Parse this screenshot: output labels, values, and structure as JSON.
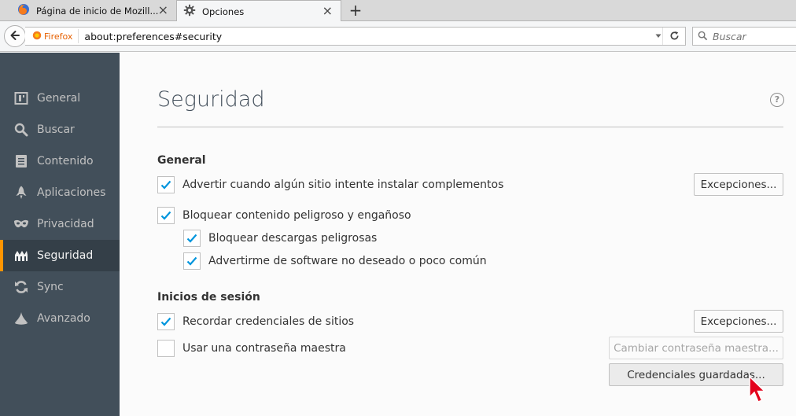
{
  "tabs": [
    {
      "title": "Página de inicio de Mozill...",
      "close": "×"
    },
    {
      "title": "Opciones",
      "close": "×"
    }
  ],
  "new_tab": "+",
  "navbar": {
    "identity_label": "Firefox",
    "url": "about:preferences#security",
    "search_placeholder": "Buscar"
  },
  "sidebar": {
    "items": [
      {
        "label": "General",
        "icon": "general-icon"
      },
      {
        "label": "Buscar",
        "icon": "search-icon"
      },
      {
        "label": "Contenido",
        "icon": "document-icon"
      },
      {
        "label": "Aplicaciones",
        "icon": "rocket-icon"
      },
      {
        "label": "Privacidad",
        "icon": "mask-icon"
      },
      {
        "label": "Seguridad",
        "icon": "security-icon",
        "selected": true
      },
      {
        "label": "Sync",
        "icon": "sync-icon"
      },
      {
        "label": "Avanzado",
        "icon": "wizard-icon"
      }
    ]
  },
  "main": {
    "title": "Seguridad",
    "help": "?",
    "general": {
      "title": "General",
      "warn_addons": "Advertir cuando algún sitio intente instalar complementos",
      "block_dangerous": "Bloquear contenido peligroso y engañoso",
      "block_downloads": "Bloquear descargas peligrosas",
      "warn_unwanted": "Advertirme de software no deseado o poco común",
      "exceptions": "Excepciones..."
    },
    "logins": {
      "title": "Inicios de sesión",
      "remember": "Recordar credenciales de sitios",
      "master_password": "Usar una contraseña maestra",
      "exceptions": "Excepciones...",
      "change_master": "Cambiar contraseña maestra...",
      "saved_logins": "Credenciales guardadas..."
    }
  },
  "colors": {
    "sidebar_bg": "#424f5a",
    "sidebar_selected": "#343f48",
    "accent": "#ff9500",
    "check": "#0095dd"
  }
}
